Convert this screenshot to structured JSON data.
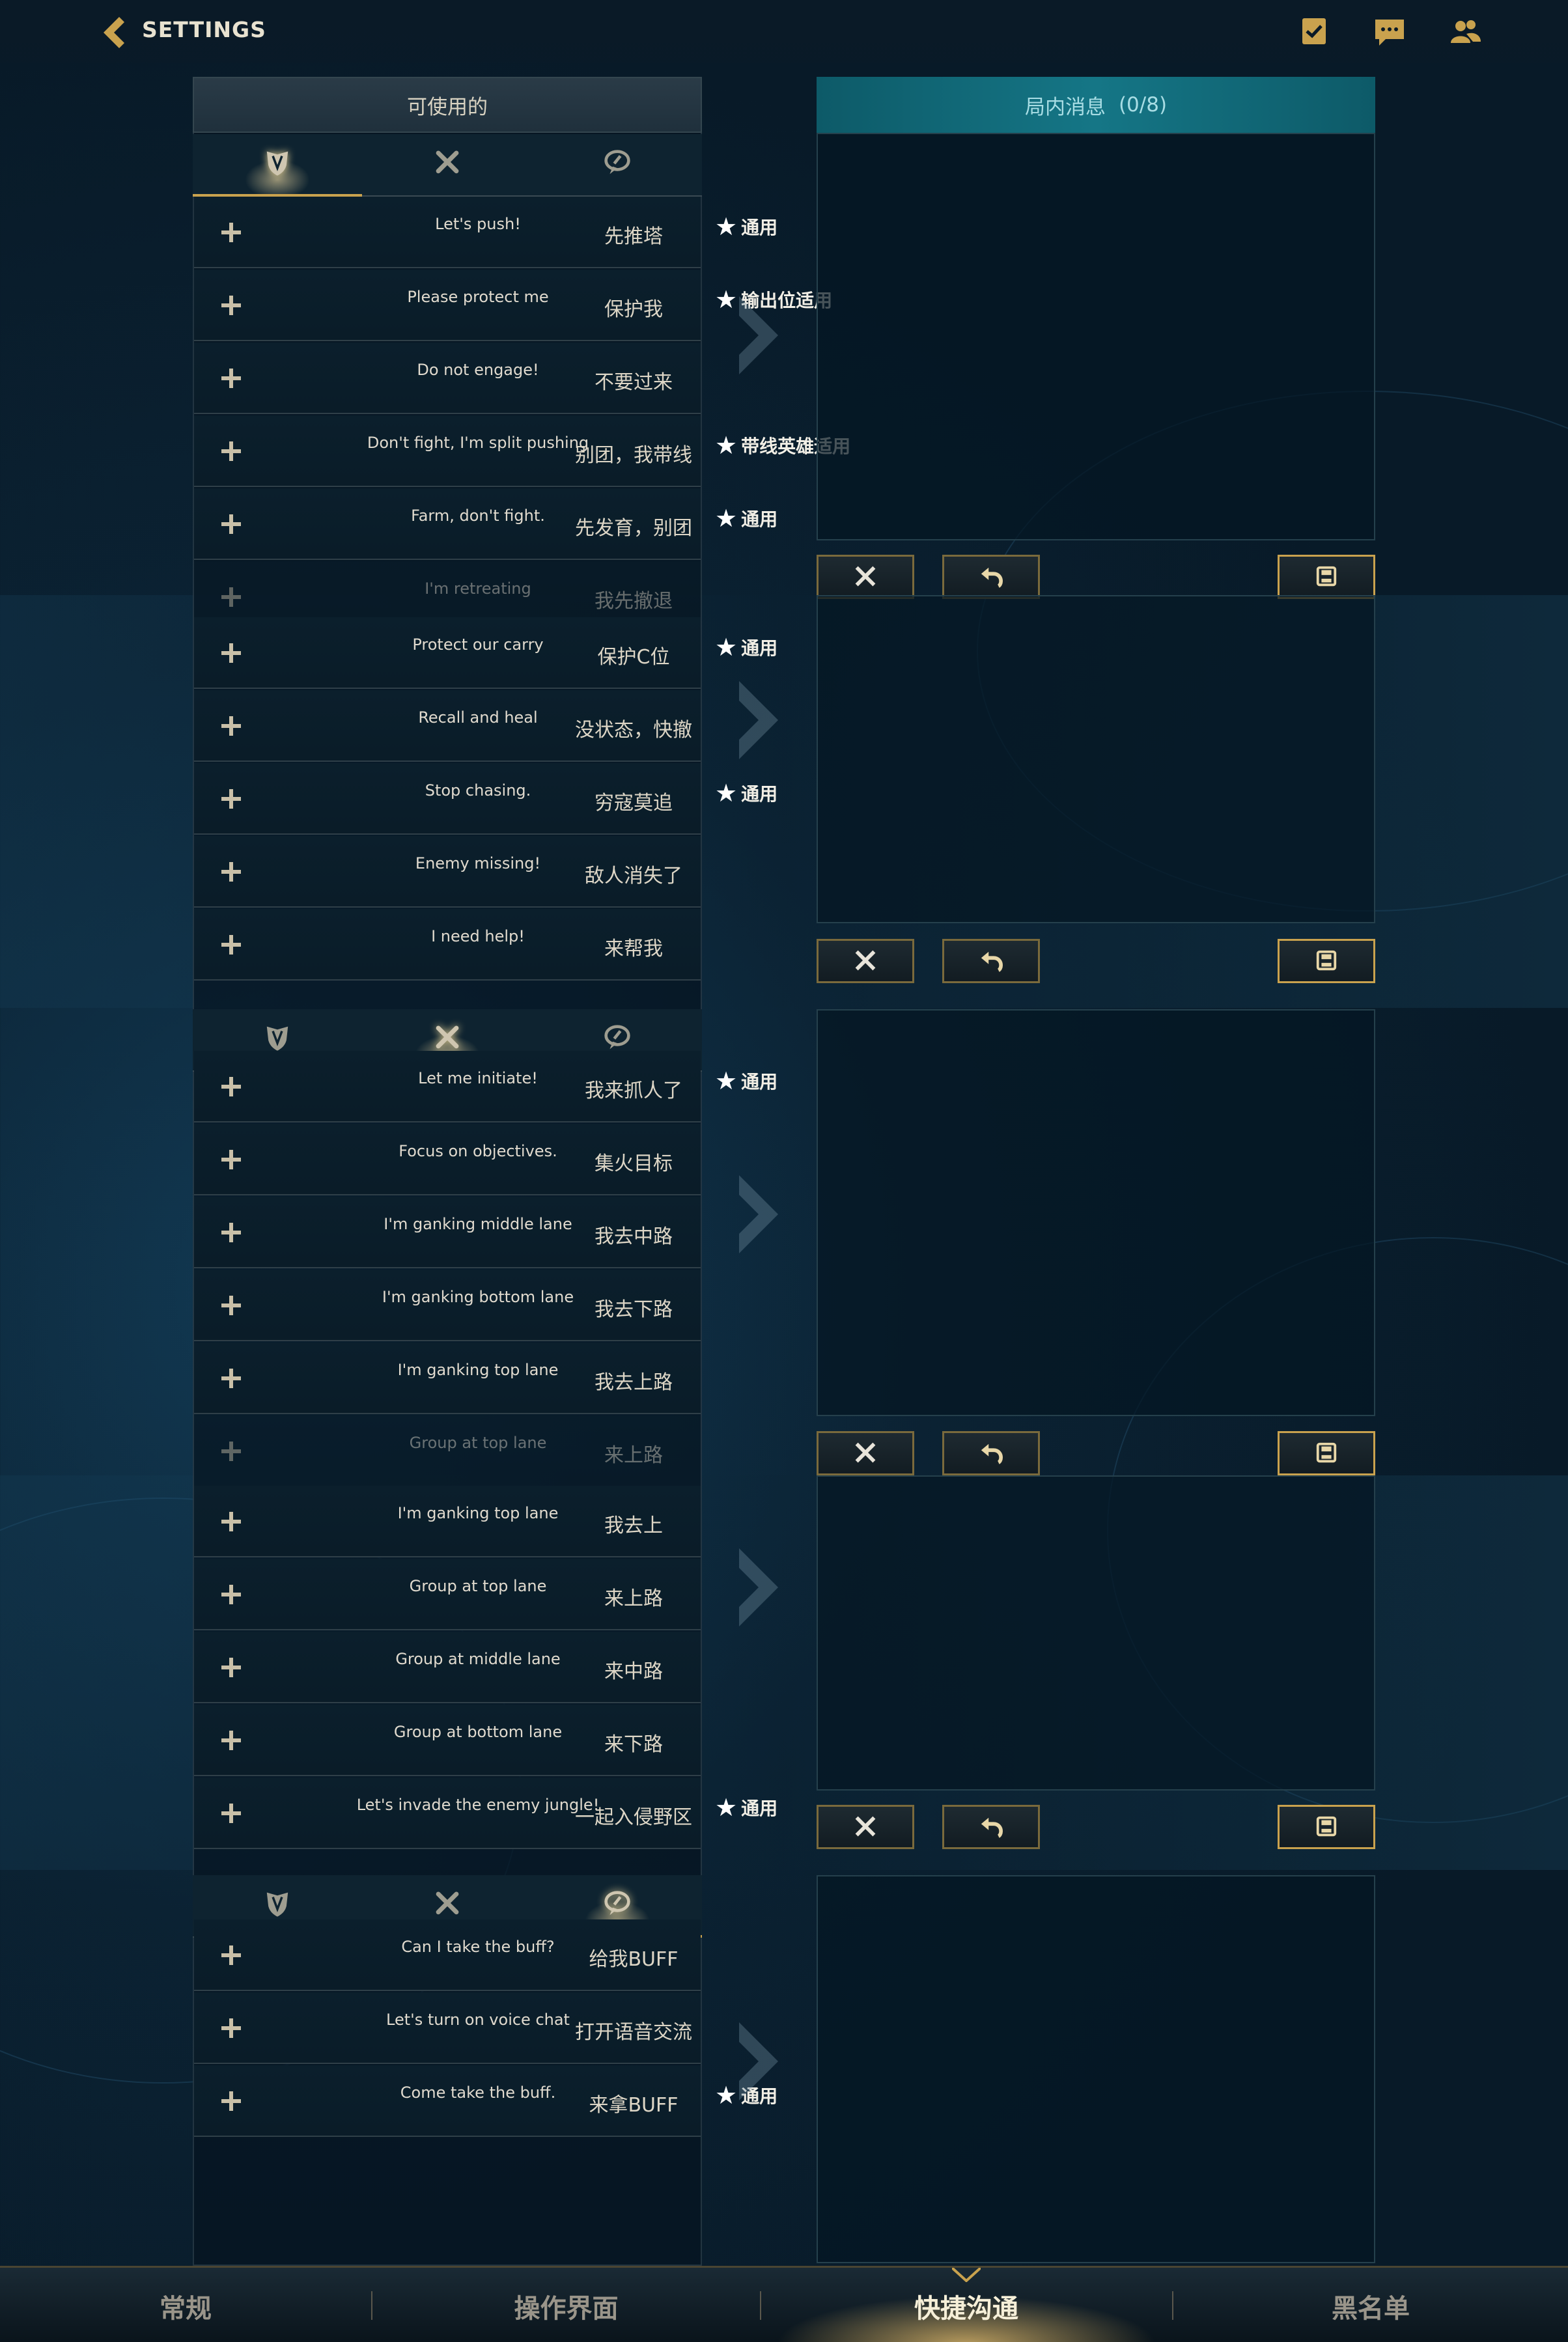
{
  "header": {
    "title": "SETTINGS"
  },
  "left_panel": {
    "title": "可使用的"
  },
  "right_panel": {
    "title": "局内消息",
    "count": "(0/8)"
  },
  "tab_icons": [
    "shield-icon",
    "crossed-swords-icon",
    "chat-bubble-icon"
  ],
  "sections": [
    {
      "active_tab": 0,
      "rows": [
        {
          "en": "Let's push!",
          "zh": "先推塔",
          "tag": "通用"
        },
        {
          "en": "Please protect me",
          "zh": "保护我",
          "tag": "输出位适用"
        },
        {
          "en": "Do not engage!",
          "zh": "不要过来",
          "tag": ""
        },
        {
          "en": "Don't fight, I'm split pushing",
          "zh": "别团，我带线",
          "tag": "带线英雄适用"
        },
        {
          "en": "Farm, don't fight.",
          "zh": "先发育，别团",
          "tag": "通用"
        },
        {
          "en": "I'm retreating",
          "zh": "我先撤退",
          "tag": ""
        }
      ]
    },
    {
      "rows": [
        {
          "en": "Protect our carry",
          "zh": "保护C位",
          "tag": "通用"
        },
        {
          "en": "Recall and heal",
          "zh": "没状态，快撤",
          "tag": ""
        },
        {
          "en": "Stop chasing.",
          "zh": "穷寇莫追",
          "tag": "通用"
        },
        {
          "en": "Enemy missing!",
          "zh": "敌人消失了",
          "tag": ""
        },
        {
          "en": "I need help!",
          "zh": "来帮我",
          "tag": ""
        }
      ]
    },
    {
      "active_tab": 1,
      "rows": [
        {
          "en": "Let me initiate!",
          "zh": "我来抓人了",
          "tag": "通用"
        },
        {
          "en": "Focus on objectives.",
          "zh": "集火目标",
          "tag": ""
        },
        {
          "en": "I'm ganking middle lane",
          "zh": "我去中路",
          "tag": ""
        },
        {
          "en": "I'm ganking bottom lane",
          "zh": "我去下路",
          "tag": ""
        },
        {
          "en": "I'm ganking top lane",
          "zh": "我去上路",
          "tag": ""
        },
        {
          "en": "Group at top lane",
          "zh": "来上路",
          "tag": ""
        }
      ]
    },
    {
      "rows": [
        {
          "en": "I'm ganking top lane",
          "zh": "我去上",
          "tag": ""
        },
        {
          "en": "Group at top lane",
          "zh": "来上路",
          "tag": ""
        },
        {
          "en": "Group at middle lane",
          "zh": "来中路",
          "tag": ""
        },
        {
          "en": "Group at bottom lane",
          "zh": "来下路",
          "tag": ""
        },
        {
          "en": "Let's invade the enemy jungle!",
          "zh": "一起入侵野区",
          "tag": "通用"
        }
      ]
    },
    {
      "active_tab": 2,
      "rows": [
        {
          "en": "Can I take the buff?",
          "zh": "给我BUFF",
          "tag": ""
        },
        {
          "en": "Let's turn on voice chat",
          "zh": "打开语音交流",
          "tag": ""
        },
        {
          "en": "Come take the buff.",
          "zh": "来拿BUFF",
          "tag": "通用"
        }
      ]
    }
  ],
  "bottom_tabs": [
    "常规",
    "操作界面",
    "快捷沟通",
    "黑名单"
  ],
  "active_bottom_tab": "快捷沟通",
  "colors": {
    "gold": "#c9a24e",
    "teal_header": "#157686",
    "background": "#081a28"
  }
}
